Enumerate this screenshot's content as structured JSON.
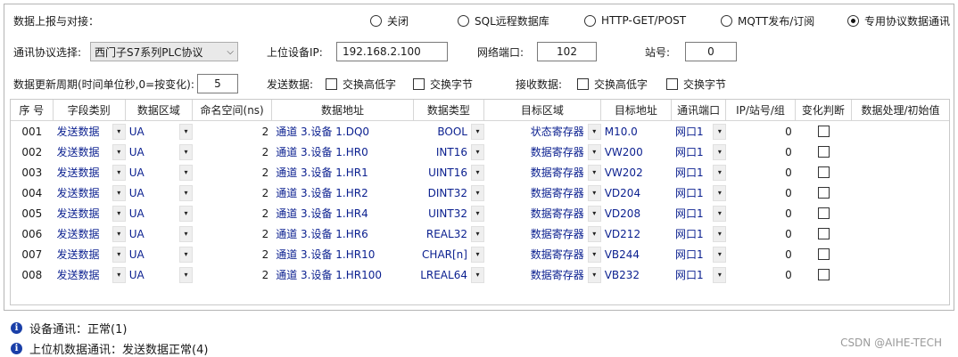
{
  "report": {
    "label": "数据上报与对接：",
    "options": [
      "关闭",
      "SQL远程数据库",
      "HTTP-GET/POST",
      "MQTT发布/订阅",
      "专用协议数据通讯"
    ],
    "selected_index": 4
  },
  "comm": {
    "protocol_label": "通讯协议选择:",
    "protocol_value": "西门子S7系列PLC协议",
    "ip_label": "上位设备IP:",
    "ip_value": "192.168.2.100",
    "port_label": "网络端口:",
    "port_value": "102",
    "station_label": "站号:",
    "station_value": "0"
  },
  "update": {
    "period_label": "数据更新周期(时间单位秒,0=按变化):",
    "period_value": "5",
    "send_label": "发送数据:",
    "send_swap_word": "交换高低字",
    "send_swap_byte": "交换字节",
    "recv_label": "接收数据:",
    "recv_swap_word": "交换高低字",
    "recv_swap_byte": "交换字节"
  },
  "table": {
    "headers": [
      "序 号",
      "字段类别",
      "数据区域",
      "命名空间(ns)",
      "数据地址",
      "数据类型",
      "目标区域",
      "目标地址",
      "通讯端口",
      "IP/站号/组",
      "变化判断",
      "数据处理/初始值"
    ],
    "rows": [
      {
        "no": "001",
        "cat": "发送数据",
        "area": "UA",
        "ns": "2",
        "addr": "通道 3.设备 1.DQ0",
        "type": "BOOL",
        "target": "状态寄存器",
        "taddr": "M10.0",
        "port": "网口1",
        "ip": "0"
      },
      {
        "no": "002",
        "cat": "发送数据",
        "area": "UA",
        "ns": "2",
        "addr": "通道 3.设备 1.HR0",
        "type": "INT16",
        "target": "数据寄存器",
        "taddr": "VW200",
        "port": "网口1",
        "ip": "0"
      },
      {
        "no": "003",
        "cat": "发送数据",
        "area": "UA",
        "ns": "2",
        "addr": "通道 3.设备 1.HR1",
        "type": "UINT16",
        "target": "数据寄存器",
        "taddr": "VW202",
        "port": "网口1",
        "ip": "0"
      },
      {
        "no": "004",
        "cat": "发送数据",
        "area": "UA",
        "ns": "2",
        "addr": "通道 3.设备 1.HR2",
        "type": "DINT32",
        "target": "数据寄存器",
        "taddr": "VD204",
        "port": "网口1",
        "ip": "0"
      },
      {
        "no": "005",
        "cat": "发送数据",
        "area": "UA",
        "ns": "2",
        "addr": "通道 3.设备 1.HR4",
        "type": "UINT32",
        "target": "数据寄存器",
        "taddr": "VD208",
        "port": "网口1",
        "ip": "0"
      },
      {
        "no": "006",
        "cat": "发送数据",
        "area": "UA",
        "ns": "2",
        "addr": "通道 3.设备 1.HR6",
        "type": "REAL32",
        "target": "数据寄存器",
        "taddr": "VD212",
        "port": "网口1",
        "ip": "0"
      },
      {
        "no": "007",
        "cat": "发送数据",
        "area": "UA",
        "ns": "2",
        "addr": "通道 3.设备 1.HR10",
        "type": "CHAR[n]",
        "target": "数据寄存器",
        "taddr": "VB244",
        "port": "网口1",
        "ip": "0"
      },
      {
        "no": "008",
        "cat": "发送数据",
        "area": "UA",
        "ns": "2",
        "addr": "通道 3.设备 1.HR100",
        "type": "LREAL64",
        "target": "数据寄存器",
        "taddr": "VB232",
        "port": "网口1",
        "ip": "0"
      }
    ]
  },
  "status": {
    "device_comm": "设备通讯：正常(1)",
    "host_comm": "上位机数据通讯：发送数据正常(4)",
    "watermark": "CSDN @AIHE-TECH"
  }
}
